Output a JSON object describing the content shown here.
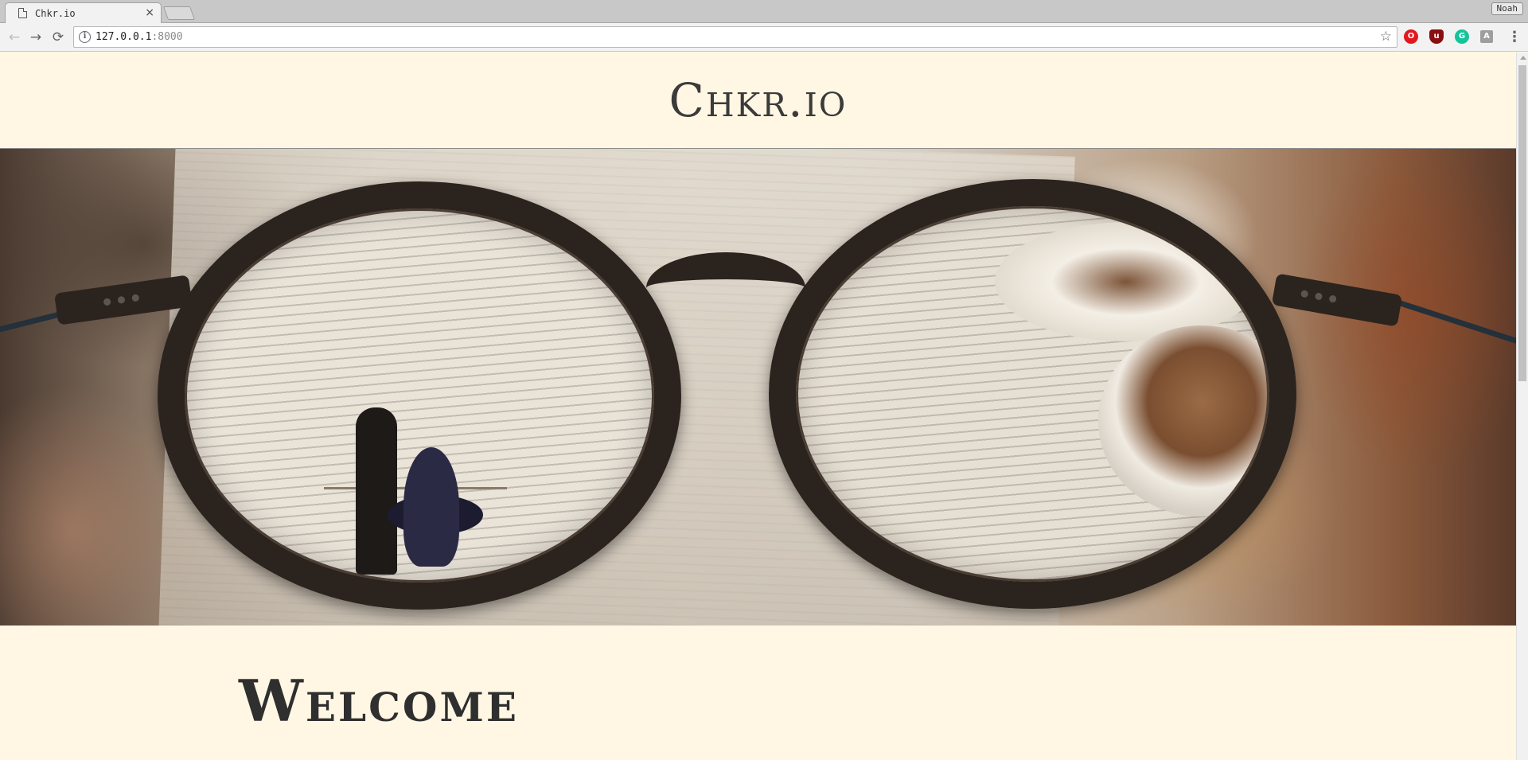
{
  "browser": {
    "tab": {
      "title": "Chkr.io",
      "close_glyph": "×"
    },
    "profile_name": "Noah",
    "nav": {
      "back_glyph": "←",
      "forward_glyph": "→",
      "reload_glyph": "⟳"
    },
    "address": {
      "host": "127.0.0.1",
      "port": ":8000"
    },
    "star_glyph": "☆",
    "menu_glyph": "⋮",
    "extensions": [
      {
        "name": "opera-icon",
        "glyph": "O"
      },
      {
        "name": "ublock-icon",
        "glyph": "u"
      },
      {
        "name": "grammarly-icon",
        "glyph": "G"
      },
      {
        "name": "font-icon",
        "glyph": "A"
      }
    ]
  },
  "site": {
    "brand": "Chkr.io",
    "welcome_heading": "Welcome"
  },
  "colors": {
    "page_background": "#fff7e4",
    "brand_text": "#3b3b3b",
    "frame": "#2b231e"
  }
}
